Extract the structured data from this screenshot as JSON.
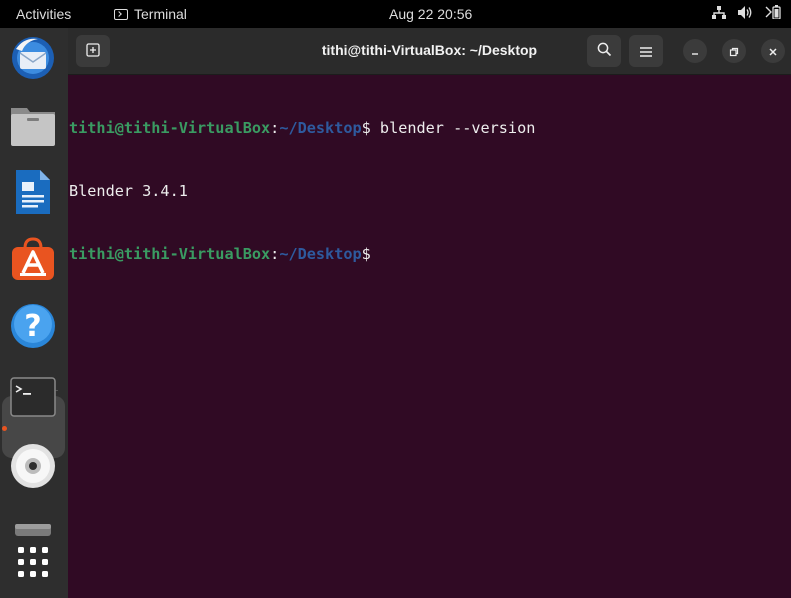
{
  "topbar": {
    "activities": "Activities",
    "app_name": "Terminal",
    "clock": "Aug 22  20:56",
    "tray_icons": [
      "network-icon",
      "volume-icon",
      "battery-icon"
    ]
  },
  "dock": {
    "items": [
      "thunderbird-icon",
      "files-icon",
      "writer-icon",
      "app-center-icon",
      "help-icon",
      "terminal-icon",
      "disc-icon",
      "drive-icon",
      "app-grid-icon"
    ],
    "accent": "#e95420"
  },
  "window": {
    "title": "tithi@tithi-VirtualBox: ~/Desktop",
    "new_tab_icon": "new-tab-icon",
    "search_icon": "search-icon",
    "menu_icon": "hamburger-menu-icon",
    "minimize_icon": "minimize-icon",
    "maximize_icon": "restore-icon",
    "close_icon": "close-icon"
  },
  "terminal": {
    "background": "#300a24",
    "lines": [
      {
        "user": "tithi@tithi-VirtualBox",
        "sep": ":",
        "path": "~/Desktop",
        "prompt": "$ ",
        "cmd": "blender --version"
      },
      {
        "output": "Blender 3.4.1"
      },
      {
        "user": "tithi@tithi-VirtualBox",
        "sep": ":",
        "path": "~/Desktop",
        "prompt": "$",
        "cmd": ""
      }
    ]
  }
}
